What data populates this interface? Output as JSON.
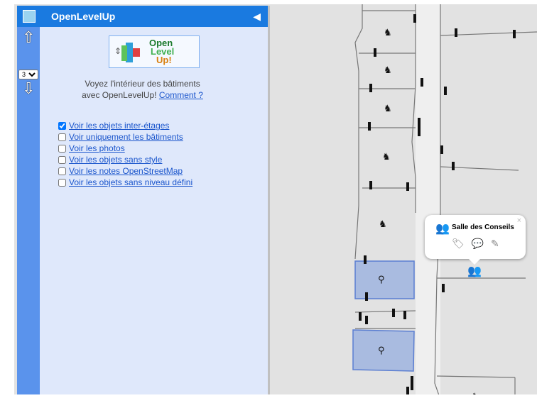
{
  "header": {
    "title": "OpenLevelUp"
  },
  "logo": {
    "line1": "Open",
    "line2": "Level",
    "line3": "Up!"
  },
  "intro": {
    "line1": "Voyez l'intérieur des bâtiments",
    "line2": "avec OpenLevelUp!",
    "link": "Comment ?"
  },
  "level": {
    "value": "3"
  },
  "options": [
    {
      "label": "Voir les objets inter-étages",
      "checked": true
    },
    {
      "label": "Voir uniquement les bâtiments",
      "checked": false
    },
    {
      "label": "Voir les photos",
      "checked": false
    },
    {
      "label": "Voir les objets sans style",
      "checked": false
    },
    {
      "label": "Voir les notes OpenStreetMap",
      "checked": false
    },
    {
      "label": "Voir les objets sans niveau défini",
      "checked": false
    }
  ],
  "popup": {
    "title": "Salle des Conseils",
    "close": "×"
  },
  "icons": {
    "up": "arrow-up-icon",
    "down": "arrow-down-icon",
    "collapse": "collapse-left-icon",
    "group": "group-icon",
    "tag": "tag-icon",
    "comment": "comment-icon",
    "edit": "edit-icon"
  },
  "colors": {
    "header": "#1a7ae0",
    "sidebar": "#dfe8fb",
    "levelbar": "#5a93ec",
    "selection": "#a9bbe0"
  }
}
